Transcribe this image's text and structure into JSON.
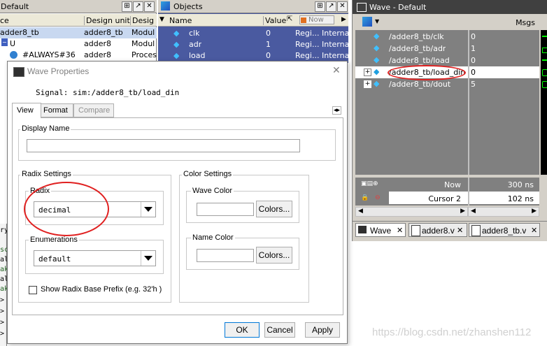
{
  "structure_panel": {
    "title": "Default",
    "columns": [
      "ce",
      "Design unit",
      "Desig"
    ],
    "rows": [
      {
        "name": "adder8_tb",
        "unit": "adder8_tb",
        "type": "Modul"
      },
      {
        "name": "U",
        "unit": "adder8",
        "type": "Modul"
      },
      {
        "name": "#ALWAYS#36",
        "unit": "adder8",
        "type": "Proces"
      }
    ],
    "left_partial": [
      "ry",
      "sc",
      "al",
      "ak",
      "al",
      "ak",
      ">",
      ">",
      ">",
      ">"
    ]
  },
  "objects_panel": {
    "title": "Objects",
    "columns": {
      "name": "Name",
      "value": "Value",
      "now": "Now"
    },
    "rows": [
      {
        "name": "clk",
        "value": "0",
        "kind": "Regi...",
        "mode": "Interna"
      },
      {
        "name": "adr",
        "value": "1",
        "kind": "Regi...",
        "mode": "Interna"
      },
      {
        "name": "load",
        "value": "0",
        "kind": "Regi...",
        "mode": "Interna"
      }
    ]
  },
  "wave_panel": {
    "title": "Wave - Default",
    "msgs_label": "Msgs",
    "signals": [
      {
        "path": "/adder8_tb/clk",
        "value": "0",
        "expand": ""
      },
      {
        "path": "/adder8_tb/adr",
        "value": "1",
        "expand": ""
      },
      {
        "path": "/adder8_tb/load",
        "value": "0",
        "expand": ""
      },
      {
        "path": "/adder8_tb/load_din",
        "value": "0",
        "expand": "+"
      },
      {
        "path": "/adder8_tb/dout",
        "value": "5",
        "expand": "+"
      }
    ],
    "now_label": "Now",
    "now_value": "300 ns",
    "cursor_label": "Cursor 2",
    "cursor_value": "102 ns",
    "tabs": [
      "Wave",
      "adder8.v",
      "adder8_tb.v"
    ]
  },
  "dialog": {
    "title": "Wave Properties",
    "signal_text": "Signal: sim:/adder8_tb/load_din",
    "tabs": [
      "View",
      "Format",
      "Compare"
    ],
    "display_name_label": "Display Name",
    "display_name_value": "",
    "radix_settings_label": "Radix Settings",
    "radix_label": "Radix",
    "radix_value": "decimal",
    "enumerations_label": "Enumerations",
    "enumerations_value": "default",
    "checkbox_label": "Show Radix Base Prefix (e.g. 32'h )",
    "checkbox_checked": false,
    "color_settings_label": "Color Settings",
    "wave_color_label": "Wave Color",
    "name_color_label": "Name Color",
    "colors_button": "Colors...",
    "ok": "OK",
    "cancel": "Cancel",
    "apply": "Apply"
  },
  "watermark": "https://blog.csdn.net/zhanshen112",
  "colors": {
    "wave_bg": "#000000",
    "wave_name_bg": "#808080",
    "highlight_row": "#ffffff",
    "selection_blue": "#4a5aa0",
    "annotation_red": "#e02020",
    "wave_green": "#00ff00"
  }
}
